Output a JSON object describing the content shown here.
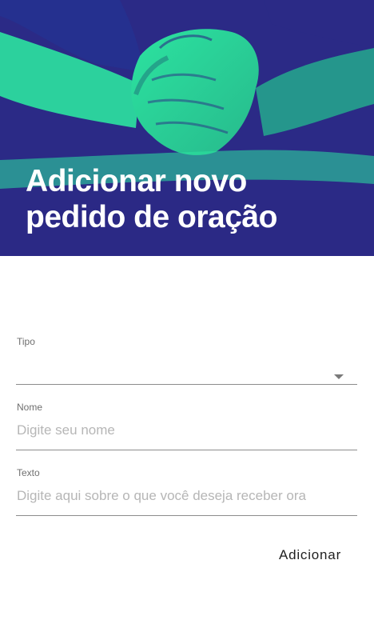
{
  "header": {
    "title_line1": "Adicionar novo",
    "title_line2": "pedido de oração",
    "image": "praying-hands-duotone",
    "colors": {
      "background": "#2b2a86",
      "accent": "#2ce3a0"
    }
  },
  "form": {
    "tipo": {
      "label": "Tipo",
      "value": "",
      "icon": "chevron-down-icon"
    },
    "nome": {
      "label": "Nome",
      "placeholder": "Digite seu nome"
    },
    "texto": {
      "label": "Texto",
      "placeholder": "Digite aqui sobre o que você deseja receber ora"
    },
    "submit_label": "Adicionar"
  }
}
